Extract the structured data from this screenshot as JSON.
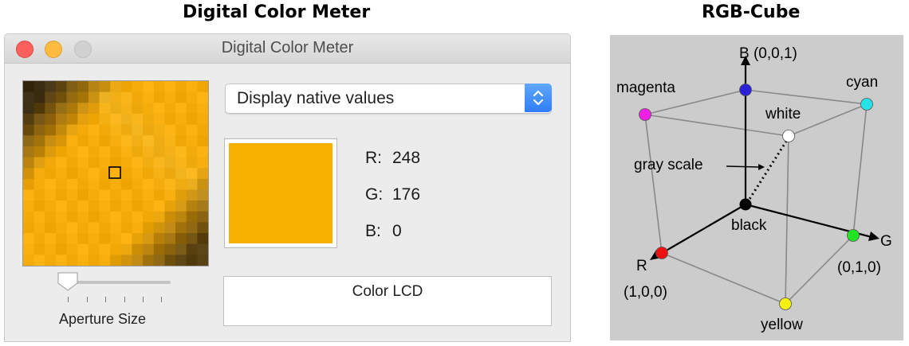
{
  "captions": {
    "left": "Digital Color Meter",
    "right": "RGB-Cube"
  },
  "window": {
    "title": "Digital Color Meter",
    "controls": [
      "close-icon",
      "minimize-icon",
      "zoom-icon"
    ],
    "display_mode": "Display native values",
    "color": {
      "hex": "#f8b000",
      "r_label": "R:",
      "r": "248",
      "g_label": "G:",
      "g": "176",
      "b_label": "B:",
      "b": "0"
    },
    "display_name": "Color LCD",
    "aperture_label": "Aperture Size",
    "aperture_level": 0
  },
  "cube": {
    "b_axis": "B (0,0,1)",
    "magenta": "magenta",
    "cyan": "cyan",
    "white": "white",
    "gray_scale": "gray scale",
    "black": "black",
    "g_axis": "G",
    "g_coord": "(0,1,0)",
    "r_axis": "R",
    "r_coord": "(1,0,0)",
    "yellow": "yellow",
    "colors": {
      "blue": "#2b22d6",
      "magenta": "#f21ee6",
      "cyan": "#26e3ea",
      "white": "#ffffff",
      "black": "#000000",
      "green": "#22e522",
      "red": "#ee1111",
      "yellow": "#f5f010"
    }
  }
}
